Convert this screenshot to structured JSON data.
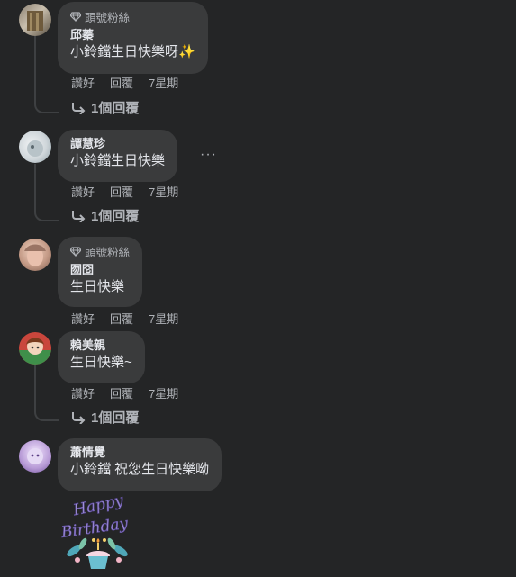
{
  "comments": [
    {
      "badge": "頭號粉絲",
      "author": "邱蓁",
      "text": "小鈴鐺生日快樂呀",
      "emoji": "✨",
      "like": "讚好",
      "reply": "回覆",
      "time": "7星期",
      "replies": "1個回覆"
    },
    {
      "author": "譚慧珍",
      "text": "小鈴鐺生日快樂",
      "like": "讚好",
      "reply": "回覆",
      "time": "7星期",
      "replies": "1個回覆",
      "more": "···"
    },
    {
      "badge": "頭號粉絲",
      "author": "囫囵",
      "text": "生日快樂",
      "like": "讚好",
      "reply": "回覆",
      "time": "7星期"
    },
    {
      "author": "賴美親",
      "text": "生日快樂~",
      "like": "讚好",
      "reply": "回覆",
      "time": "7星期",
      "replies": "1個回覆"
    },
    {
      "author": "蕭情覺",
      "text": "小鈴鐺 祝您生日快樂呦"
    }
  ],
  "sticker": {
    "line1": "Happy",
    "line2": "Birthday"
  },
  "icons": {
    "badge": "diamond-icon",
    "reply_arrow": "reply-arrow-icon"
  },
  "colors": {
    "background": "#242526",
    "bubble": "#3a3b3c",
    "text": "#e4e6eb",
    "muted": "#b0b3b8"
  }
}
